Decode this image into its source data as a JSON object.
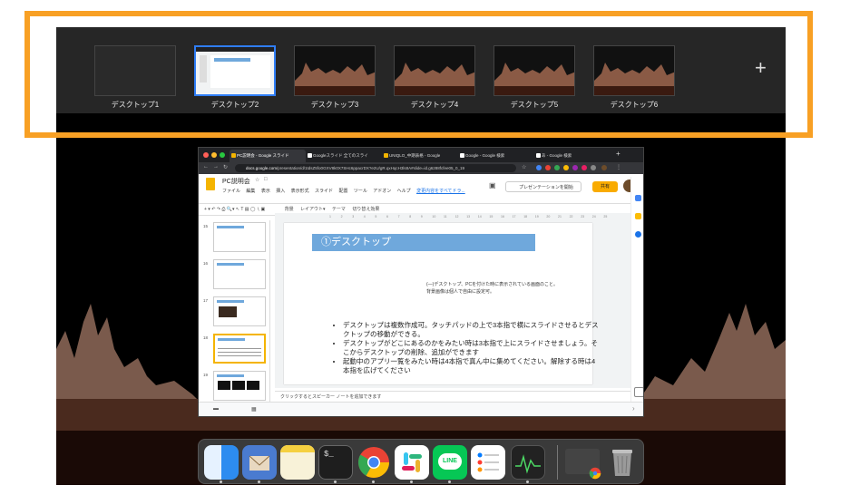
{
  "spaces": {
    "desktops": [
      {
        "label": "デスクトップ1",
        "selected": false,
        "style": "dark"
      },
      {
        "label": "デスクトップ2",
        "selected": true,
        "style": "slides"
      },
      {
        "label": "デスクトップ3",
        "selected": false,
        "style": "rocks"
      },
      {
        "label": "デスクトップ4",
        "selected": false,
        "style": "rocks"
      },
      {
        "label": "デスクトップ5",
        "selected": false,
        "style": "rocks"
      },
      {
        "label": "デスクトップ6",
        "selected": false,
        "style": "rocks"
      }
    ],
    "add_label": "+",
    "highlight_color": "#f8a024"
  },
  "browser": {
    "tabs": [
      {
        "label": "PC説明会 - Google スライド",
        "active": true,
        "favicon_color": "#f4b400"
      },
      {
        "label": "Googleスライド 全てのスライ",
        "active": false,
        "favicon_color": "#ffffff"
      },
      {
        "label": "UNIQLO_中期表格 - Google",
        "active": false,
        "favicon_color": "#f4b400"
      },
      {
        "label": "Google - Google 検索",
        "active": false,
        "favicon_color": "#ffffff"
      },
      {
        "label": "あ - Google 検索",
        "active": false,
        "favicon_color": "#ffffff"
      }
    ],
    "url_host": "docs.google.com",
    "url_path": "/presentation/d/1tdsZ5fo0GXV8k0X7SHc6ppacrDX?e2U/gR.qxHqcH3ls8A#slide=id.g6288fcfee05_0_19"
  },
  "slides_app": {
    "doc_title": "PC説明会",
    "menu": [
      "ファイル",
      "編集",
      "表示",
      "挿入",
      "表示形式",
      "スライド",
      "配置",
      "ツール",
      "アドオン",
      "ヘルプ"
    ],
    "last_edit": "変更内容をすべてドラ...",
    "present_label": "プレゼンテーションを開始",
    "share_label": "共有",
    "toolbar_items": [
      "背景",
      "レイアウト▾",
      "テーマ",
      "切り替え効果"
    ],
    "thumbnails": [
      {
        "num": "15",
        "selected": false
      },
      {
        "num": "16",
        "selected": false
      },
      {
        "num": "17",
        "selected": false
      },
      {
        "num": "18",
        "selected": true
      },
      {
        "num": "19",
        "selected": false
      }
    ],
    "ruler_ticks": [
      "1",
      "2",
      "3",
      "4",
      "5",
      "6",
      "7",
      "8",
      "9",
      "10",
      "11",
      "12",
      "13",
      "14",
      "15",
      "16",
      "17",
      "18",
      "19",
      "20",
      "21",
      "22",
      "23",
      "24",
      "25"
    ],
    "slide": {
      "title": "①デスクトップ",
      "note_line1": "(—)デスクトップ、PCを付けた時に表示されている画面のこと。",
      "note_line2": "背景画像は個人で自由に設定可。",
      "bullets": [
        "デスクトップは複数作成可。タッチパッドの上で3本指で横にスライドさせるとデスクトップの移動ができる。",
        "デスクトップがどこにあるのかをみたい時は3本指で上にスライドさせましょう。そこからデスクトップの削除、追加ができます",
        "起動中のアプリ一覧をみたい時は4本指で真ん中に集めてください。解除する時は4本指を広げてください"
      ]
    },
    "notes_placeholder": "クリックするとスピーカー ノートを追加できます"
  },
  "dock": {
    "apps": [
      {
        "name": "finder-icon",
        "color": "#2d8cf0"
      },
      {
        "name": "mail-icon",
        "color": "#4a7bd0"
      },
      {
        "name": "notes-icon",
        "color": "#f5e6a8"
      },
      {
        "name": "terminal-icon",
        "color": "#1e1e1e"
      },
      {
        "name": "chrome-icon",
        "color": "#ffffff"
      },
      {
        "name": "slack-icon",
        "color": "#ffffff"
      },
      {
        "name": "line-icon",
        "color": "#06c755"
      },
      {
        "name": "reminders-icon",
        "color": "#ffffff"
      },
      {
        "name": "activity-monitor-icon",
        "color": "#222222"
      },
      {
        "name": "chrome-window-icon",
        "color": "#444444"
      },
      {
        "name": "trash-icon",
        "color": "#888888"
      }
    ]
  }
}
